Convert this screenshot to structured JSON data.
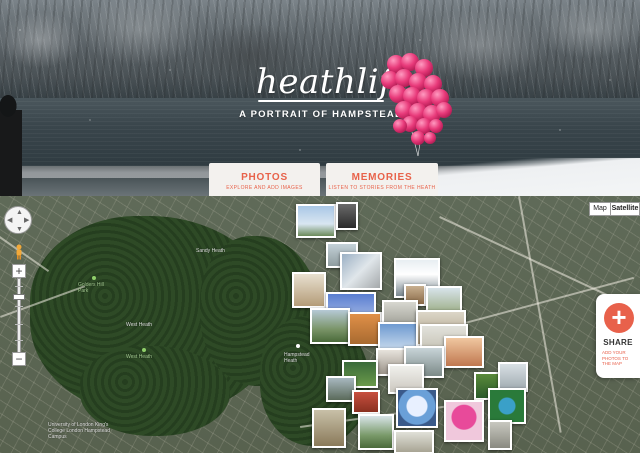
{
  "hero": {
    "logo": "heathlife",
    "tagline": "A PORTRAIT OF HAMPSTEAD HEATH"
  },
  "nav": {
    "photos": {
      "title": "PHOTOS",
      "subtitle": "EXPLORE AND ADD IMAGES"
    },
    "memories": {
      "title": "MEMORIES",
      "subtitle": "LISTEN TO STORIES FROM THE HEATH"
    }
  },
  "map": {
    "type_map": "Map",
    "type_satellite": "Satellite",
    "zoom_in": "+",
    "zoom_out": "−",
    "places": {
      "sandy_heath": "Sandy Heath",
      "golders_hill": "Golders Hill Park",
      "west_heath": "West Heath",
      "west_heath2": "West Heath",
      "hampstead_heath": "Hampstead Heath",
      "ucl": "University of London King's College London Hampstead Campus"
    }
  },
  "share": {
    "label": "SHARE",
    "subtitle": "ADD YOUR PHOTOS TO THE MAP",
    "icon": "plus-icon"
  },
  "colors": {
    "accent": "#e8614b",
    "button_bg": "#f3f1ee",
    "map_green": "#2e4a26"
  }
}
